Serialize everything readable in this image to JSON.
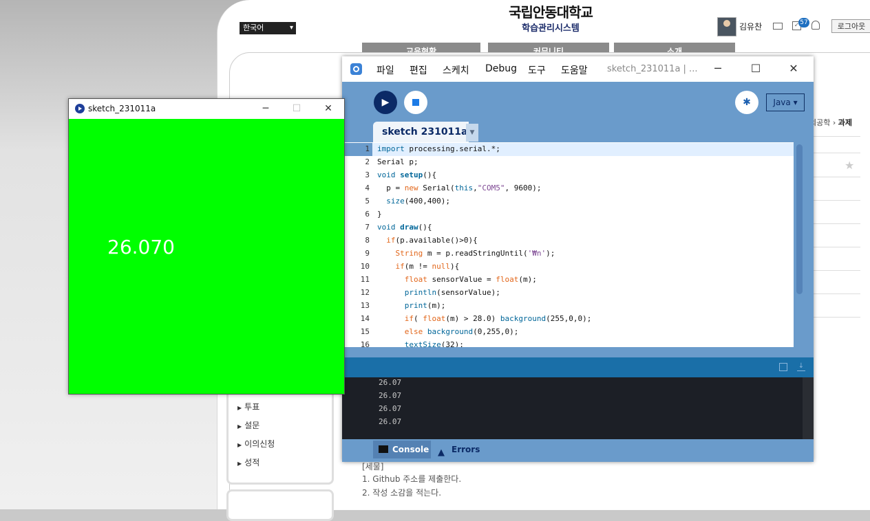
{
  "lms": {
    "language": "한국어",
    "university": "국립안동대학교",
    "system": "학습관리시스템",
    "user_name": "김유찬",
    "notification_count": "57",
    "logout": "로그아웃",
    "nav_tabs": [
      "교육현황",
      "커뮤니티",
      "소개"
    ],
    "breadcrumb_prev": "의공학",
    "breadcrumb_sep": "›",
    "breadcrumb_current": "과제",
    "side_menu": [
      "투표",
      "설문",
      "이의신청",
      "성적"
    ],
    "description_title": "[세물]",
    "description_lines": [
      "1. Github 주소를 제출한다.",
      "2. 작성 소감을 적는다."
    ]
  },
  "ide": {
    "menu": [
      "파일",
      "편집",
      "스케치",
      "Debug",
      "도구",
      "도움말"
    ],
    "title": "sketch_231011a | ...",
    "mode": "Java ▾",
    "tab": "sketch 231011a",
    "console_tab": "Console",
    "errors_tab": "Errors",
    "line_numbers": [
      "1",
      "2",
      "3",
      "4",
      "5",
      "6",
      "7",
      "8",
      "9",
      "10",
      "11",
      "12",
      "13",
      "14",
      "15",
      "16"
    ],
    "console_lines": [
      "26.07",
      "26.07",
      "26.07",
      "26.07"
    ]
  },
  "sketch": {
    "title": "sketch_231011a",
    "canvas_text": "26.070",
    "background": "#00ff00"
  },
  "colors": {
    "ide_accent": "#6a9bcb",
    "run_button": "#0b2a66",
    "console_bg": "#1c1f26"
  },
  "icons": [
    "play-icon",
    "stop-icon",
    "debug-icon",
    "mail-icon",
    "check-icon",
    "bell-icon",
    "star-icon"
  ]
}
